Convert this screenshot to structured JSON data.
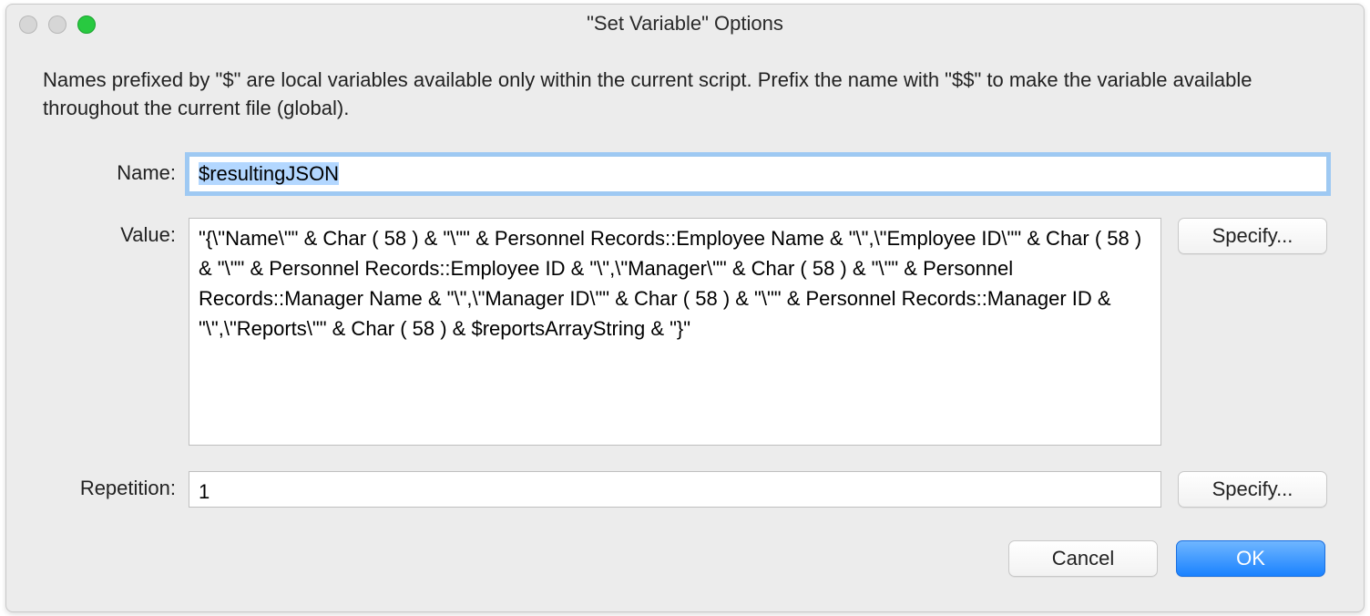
{
  "window": {
    "title": "\"Set Variable\" Options"
  },
  "description": "Names prefixed by \"$\" are local variables available only within the current script. Prefix the name with \"$$\" to make the variable available throughout the current file (global).",
  "form": {
    "name_label": "Name:",
    "value_label": "Value:",
    "repetition_label": "Repetition:",
    "fields": {
      "name": "$resultingJSON",
      "value": "\"{\\\"Name\\\"\" & Char ( 58 ) & \"\\\"\" & Personnel Records::Employee Name & \"\\\",\\\"Employee ID\\\"\" & Char ( 58 ) & \"\\\"\" & Personnel Records::Employee ID & \"\\\",\\\"Manager\\\"\" & Char ( 58 ) & \"\\\"\" & Personnel Records::Manager Name & \"\\\",\\\"Manager ID\\\"\" & Char ( 58 ) & \"\\\"\" & Personnel Records::Manager ID & \"\\\",\\\"Reports\\\"\" & Char ( 58 ) & $reportsArrayString & \"}\"",
      "repetition": "1"
    }
  },
  "buttons": {
    "specify": "Specify...",
    "cancel": "Cancel",
    "ok": "OK"
  }
}
